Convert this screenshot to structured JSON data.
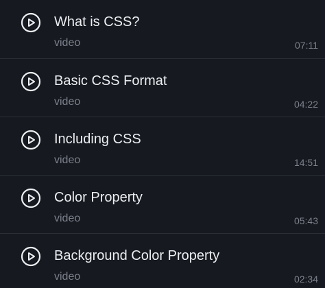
{
  "lessons": [
    {
      "title": "What is CSS?",
      "type": "video",
      "duration": "07:11"
    },
    {
      "title": "Basic CSS Format",
      "type": "video",
      "duration": "04:22"
    },
    {
      "title": "Including CSS",
      "type": "video",
      "duration": "14:51"
    },
    {
      "title": "Color Property",
      "type": "video",
      "duration": "05:43"
    },
    {
      "title": "Background Color Property",
      "type": "video",
      "duration": "02:34"
    }
  ],
  "icons": {
    "play": "play-circle-icon"
  },
  "colors": {
    "background": "#16191f",
    "title": "#eceef2",
    "muted": "#7b808b",
    "divider": "#2a2e36"
  }
}
